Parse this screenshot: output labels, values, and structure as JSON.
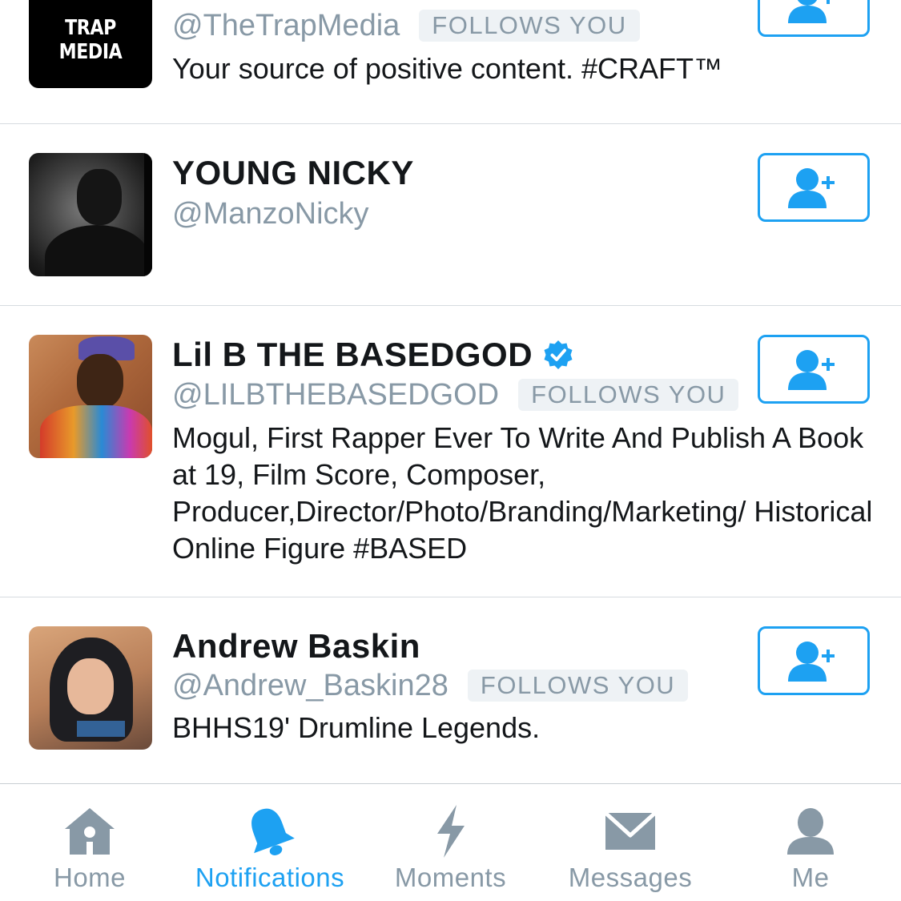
{
  "colors": {
    "accent": "#1da1f2",
    "secondary_text": "#8899a6",
    "primary_text": "#14171a",
    "divider": "#d6dbe0"
  },
  "users": [
    {
      "avatar_text": "TRAP MEDIA",
      "handle": "@TheTrapMedia",
      "follows_you": "FOLLOWS YOU",
      "bio": "Your source of positive content. #CRAFT™"
    },
    {
      "name": "YOUNG NICKY",
      "handle": "@ManzoNicky"
    },
    {
      "name": "Lil B THE BASEDGOD",
      "verified": true,
      "handle": "@LILBTHEBASEDGOD",
      "follows_you": "FOLLOWS YOU",
      "bio": "Mogul, First Rapper Ever To Write And Publish A Book at 19, Film Score, Composer, Producer,Director/Photo/Branding/Marketing/ Historical Online Figure #BASED"
    },
    {
      "name": "Andrew Baskin",
      "handle": "@Andrew_Baskin28",
      "follows_you": "FOLLOWS YOU",
      "bio": "BHHS19' Drumline Legends."
    }
  ],
  "tabbar": {
    "active": "notifications",
    "items": [
      {
        "id": "home",
        "label": "Home",
        "icon": "home-icon"
      },
      {
        "id": "notifications",
        "label": "Notifications",
        "icon": "bell-icon"
      },
      {
        "id": "moments",
        "label": "Moments",
        "icon": "lightning-icon"
      },
      {
        "id": "messages",
        "label": "Messages",
        "icon": "envelope-icon"
      },
      {
        "id": "me",
        "label": "Me",
        "icon": "person-icon"
      }
    ]
  }
}
